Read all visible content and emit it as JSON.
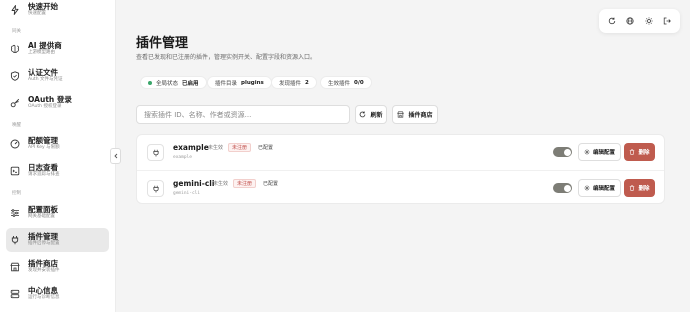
{
  "sidebar": {
    "sections": [
      "同关",
      "唤醒",
      "控制"
    ],
    "items": [
      {
        "title": "快速开始",
        "sub": "快速配置",
        "icon": "bolt-icon"
      },
      {
        "title": "AI 提供商",
        "sub": "上游模型路由",
        "icon": "brain-icon"
      },
      {
        "title": "认证文件",
        "sub": "Auth 文件与凭证",
        "icon": "shield-icon"
      },
      {
        "title": "OAuth 登录",
        "sub": "OAuth 授权登录",
        "icon": "key-icon"
      },
      {
        "title": "配额管理",
        "sub": "API Key 与限额",
        "icon": "gauge-icon"
      },
      {
        "title": "日志查看",
        "sub": "请求追踪与排查",
        "icon": "log-icon"
      },
      {
        "title": "配置面板",
        "sub": "网关基础配置",
        "icon": "sliders-icon"
      },
      {
        "title": "插件管理",
        "sub": "插件启停与配置",
        "icon": "plug-icon"
      },
      {
        "title": "插件商店",
        "sub": "发现并安装插件",
        "icon": "store-icon"
      },
      {
        "title": "中心信息",
        "sub": "运行与诊断信息",
        "icon": "server-icon"
      }
    ]
  },
  "toolbar": {
    "icons": [
      "refresh-icon",
      "globe-icon",
      "sun-icon",
      "logout-icon"
    ]
  },
  "main": {
    "title": "插件管理",
    "description": "查看已发现和已注册的插件，管理实例开关、配置字段和资源入口。",
    "stats": [
      {
        "label": "全局状态",
        "value": "已启用"
      },
      {
        "label": "插件目录",
        "value": "plugins"
      },
      {
        "label": "发现插件",
        "value": "2"
      },
      {
        "label": "生效插件",
        "value": "0/0"
      }
    ],
    "search_placeholder": "搜索插件 ID、名称、作者或资源...",
    "refresh_label": "刷新",
    "store_label": "插件商店"
  },
  "plugins": [
    {
      "name": "example",
      "id": "example",
      "state": "未生效",
      "registered": "未注册",
      "configured": "已配置",
      "enabled": true,
      "edit_label": "编辑配置",
      "delete_label": "删除"
    },
    {
      "name": "gemini-cli",
      "id": "gemini-cli",
      "state": "未生效",
      "registered": "未注册",
      "configured": "已配置",
      "enabled": true,
      "edit_label": "编辑配置",
      "delete_label": "删除"
    }
  ],
  "colors": {
    "accent_danger": "#bf5b4e",
    "status_ok": "#3aa66a",
    "active_bg": "#e9e9e9"
  }
}
